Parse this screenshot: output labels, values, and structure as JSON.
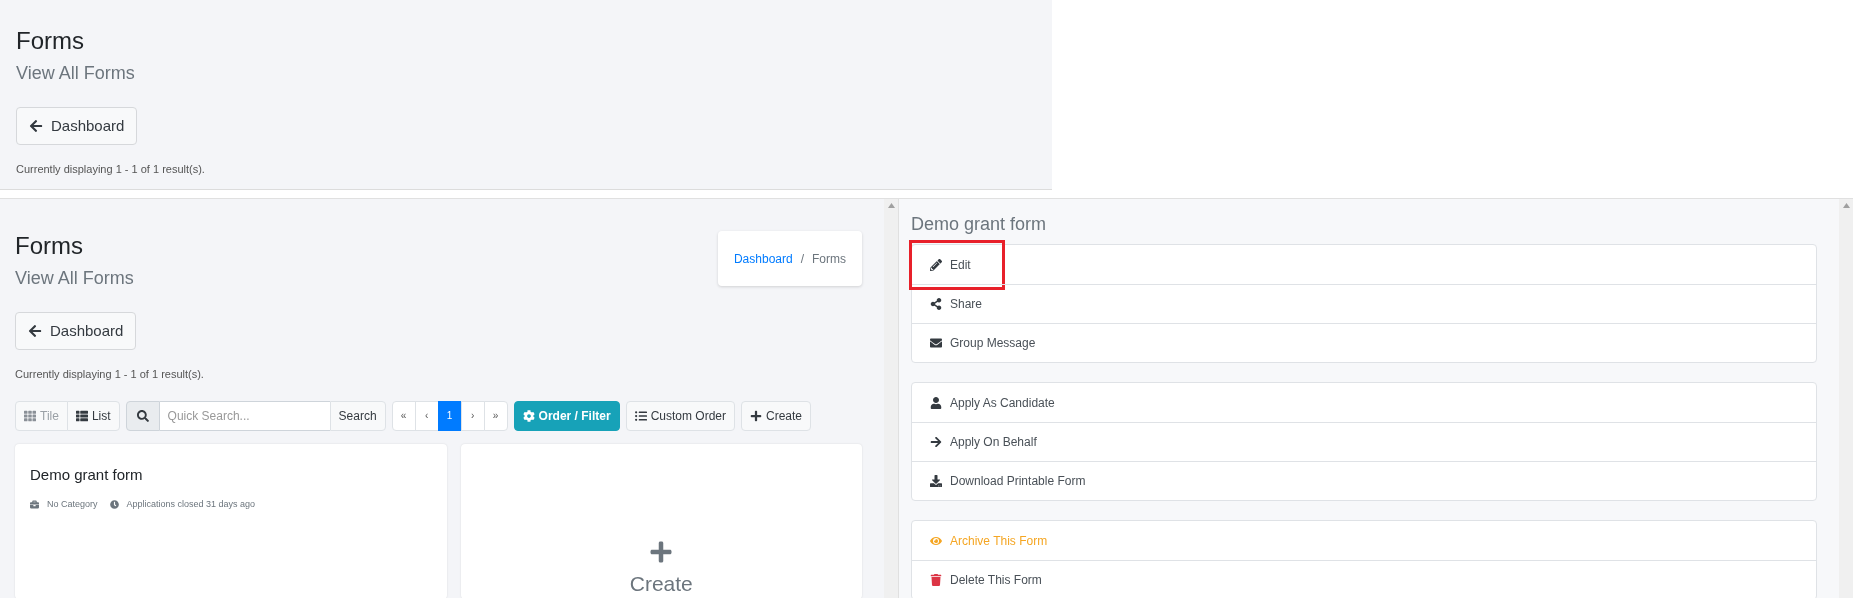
{
  "top_view": {
    "title": "Forms",
    "subtitle": "View All Forms",
    "back_button": "Dashboard",
    "result_text": "Currently displaying 1 - 1 of 1 result(s)."
  },
  "main_view": {
    "title": "Forms",
    "subtitle": "View All Forms",
    "breadcrumb": [
      {
        "label": "Dashboard",
        "kind": "link"
      },
      {
        "label": "Forms",
        "kind": "current"
      }
    ],
    "breadcrumb_separator": "/",
    "back_button": "Dashboard",
    "result_text": "Currently displaying 1 - 1 of 1 result(s).",
    "view_toggle": [
      {
        "label": "Tile",
        "selected": true
      },
      {
        "label": "List",
        "selected": false
      }
    ],
    "search": {
      "placeholder": "Quick Search...",
      "button": "Search"
    },
    "pagination": [
      {
        "label": "«",
        "selected": false
      },
      {
        "label": "‹",
        "selected": false
      },
      {
        "label": "1",
        "selected": true
      },
      {
        "label": "›",
        "selected": false
      },
      {
        "label": "»",
        "selected": false
      }
    ],
    "actions": [
      {
        "label": "Order / Filter",
        "kind": "primary"
      },
      {
        "label": "Custom Order",
        "kind": "default"
      },
      {
        "label": "Create",
        "kind": "default"
      }
    ],
    "cards": [
      {
        "kind": "form",
        "title": "Demo grant form",
        "category": "No Category",
        "status": "Applications closed 31 days ago"
      },
      {
        "kind": "create",
        "label": "Create"
      }
    ]
  },
  "detail_panel": {
    "title": "Demo grant form",
    "groups": [
      {
        "items": [
          {
            "label": "Edit",
            "kind": "edit",
            "highlighted": true
          },
          {
            "label": "Share",
            "kind": "share",
            "highlighted": false
          },
          {
            "label": "Group Message",
            "kind": "message",
            "highlighted": false
          }
        ]
      },
      {
        "items": [
          {
            "label": "Apply As Candidate",
            "kind": "candidate",
            "highlighted": false
          },
          {
            "label": "Apply On Behalf",
            "kind": "behalf",
            "highlighted": false
          },
          {
            "label": "Download Printable Form",
            "kind": "download",
            "highlighted": false
          }
        ]
      },
      {
        "items": [
          {
            "label": "Archive This Form",
            "kind": "archive",
            "highlighted": false
          },
          {
            "label": "Delete This Form",
            "kind": "delete",
            "highlighted": false
          }
        ]
      }
    ]
  }
}
